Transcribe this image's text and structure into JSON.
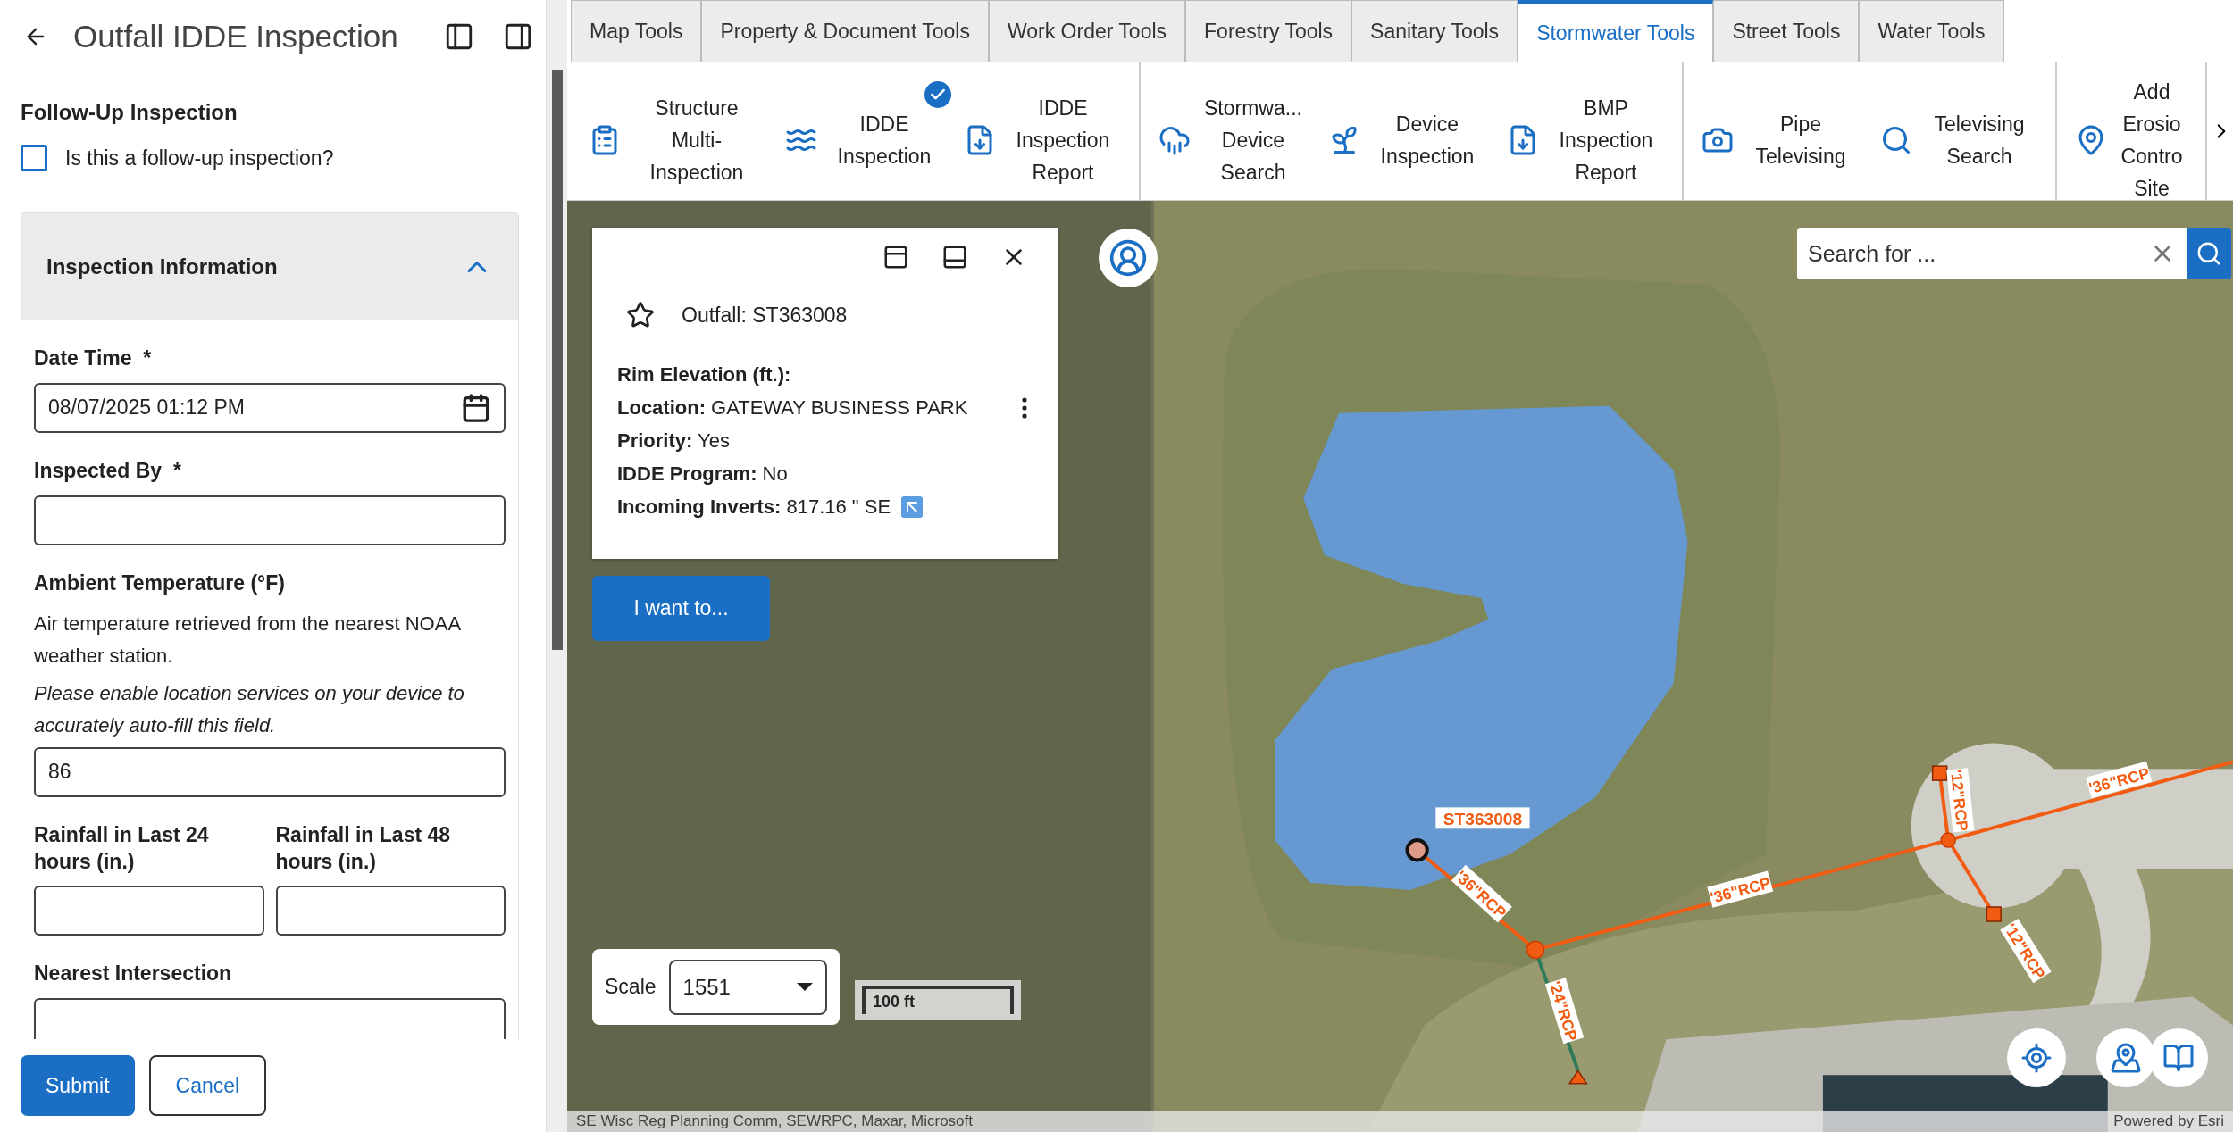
{
  "panel": {
    "title": "Outfall IDDE Inspection",
    "follow_up": {
      "heading": "Follow-Up Inspection",
      "checkbox": {
        "label": "Is this a follow-up inspection?",
        "checked": false
      }
    },
    "section": {
      "title": "Inspection Information",
      "expanded": true,
      "fields": [
        {
          "kind": "date",
          "label": "Date Time",
          "required_mark": "*",
          "value": "08/07/2025 01:12 PM"
        },
        {
          "kind": "text",
          "label": "Inspected By",
          "required_mark": "*"
        },
        {
          "kind": "text",
          "label": "Ambient Temperature (°F)",
          "help": "Air temperature retrieved from the nearest NOAA weather station.",
          "note": "Please enable location services on your device to accurately auto-fill this field.",
          "value": "86"
        },
        {
          "kind": "pair",
          "items": [
            {
              "label": "Rainfall in Last 24 hours (in.)"
            },
            {
              "label": "Rainfall in Last 48 hours (in.)"
            }
          ]
        },
        {
          "kind": "text",
          "label": "Nearest Intersection"
        }
      ]
    },
    "buttons": [
      {
        "label": "Submit",
        "kind": "primary"
      },
      {
        "label": "Cancel",
        "kind": "secondary"
      }
    ]
  },
  "toolbar": {
    "tabs": [
      {
        "label": "Map Tools",
        "selected": false
      },
      {
        "label": "Property & Document Tools",
        "selected": false
      },
      {
        "label": "Work Order Tools",
        "selected": false
      },
      {
        "label": "Forestry Tools",
        "selected": false
      },
      {
        "label": "Sanitary Tools",
        "selected": false
      },
      {
        "label": "Stormwater Tools",
        "selected": true
      },
      {
        "label": "Street Tools",
        "selected": false
      },
      {
        "label": "Water Tools",
        "selected": false
      }
    ],
    "groups": [
      {
        "tools": [
          {
            "label": "Structure Multi-Inspection",
            "checked": false
          },
          {
            "label": "IDDE Inspection",
            "checked": true
          },
          {
            "label": "IDDE Inspection Report",
            "checked": false
          }
        ]
      },
      {
        "tools": [
          {
            "label": "Stormwa... Device Search",
            "checked": false
          },
          {
            "label": "Device Inspection",
            "checked": false
          },
          {
            "label": "BMP Inspection Report",
            "checked": false
          }
        ]
      },
      {
        "tools": [
          {
            "label": "Pipe Televising",
            "checked": false
          },
          {
            "label": "Televising Search",
            "checked": false
          }
        ]
      },
      {
        "tools": [
          {
            "label": "Add Erosio Contro Site",
            "checked": false
          }
        ]
      }
    ]
  },
  "map": {
    "popup": {
      "title": "Outfall: ST363008",
      "attributes": [
        {
          "label": "Rim Elevation (ft.):"
        },
        {
          "label": "Location:",
          "value": "GATEWAY BUSINESS PARK"
        },
        {
          "label": "Priority:",
          "value": "Yes"
        },
        {
          "label": "IDDE Program:",
          "value": "No"
        },
        {
          "label": "Incoming Inverts:",
          "value": "817.16 \" SE"
        }
      ]
    },
    "action_button": "I want to...",
    "search": {
      "placeholder": "Search for ..."
    },
    "scale": {
      "label": "Scale",
      "value": "1551"
    },
    "scale_bar": "100 ft",
    "feature_label": "ST363008",
    "pipe_labels": [
      "'36\"RCP",
      "'36\"RCP",
      "'36\"RCP",
      "'12\"RCP",
      "'12\"RCP",
      "'24\"RCP"
    ],
    "attribution": "SE Wisc Reg Planning Comm, SEWRPC, Maxar, Microsoft",
    "powered_by": "Powered by Esri"
  }
}
